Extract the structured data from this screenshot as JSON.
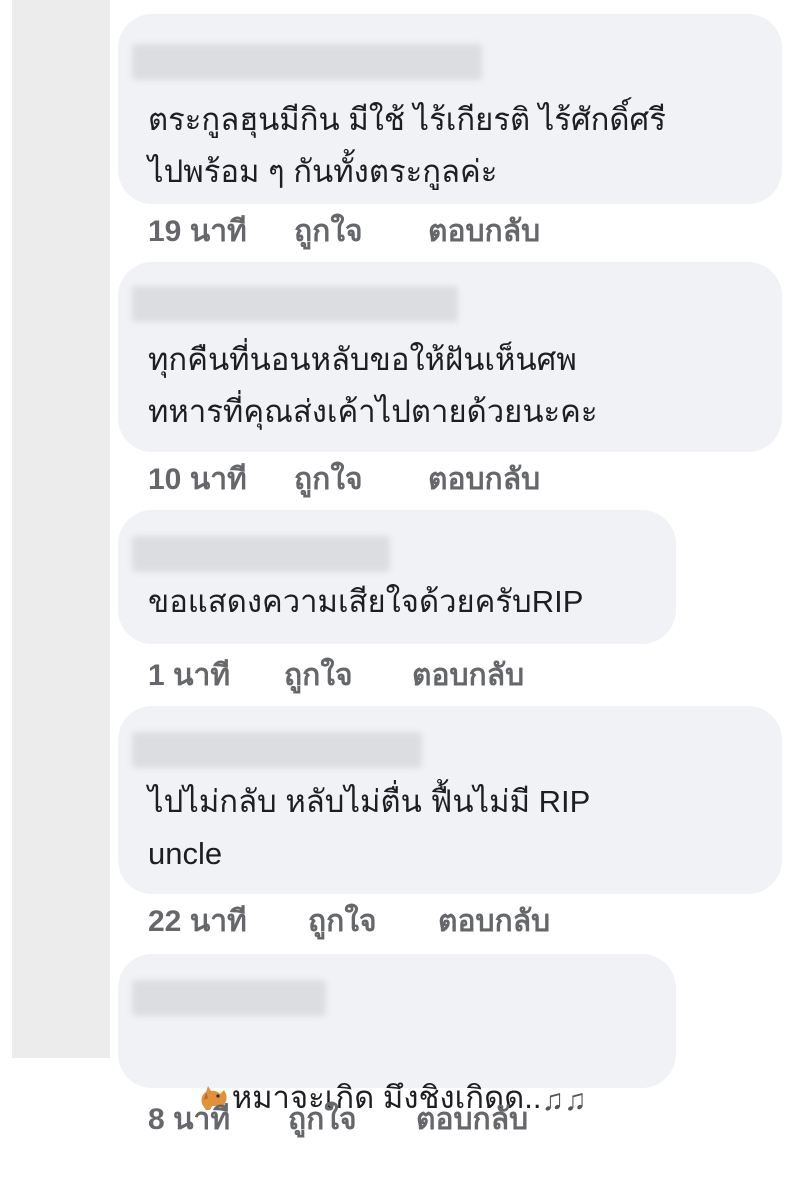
{
  "comments": [
    {
      "text": "ตระกูลฮุนมีกิน มีใช้ ไร้เกียรติ ไร้ศักดิ์ศรี\nไปพร้อม ๆ กันทั้งตระกูลค่ะ",
      "time": "19 นาที",
      "like": "ถูกใจ",
      "reply": "ตอบกลับ"
    },
    {
      "text": "ทุกคืนที่นอนหลับขอให้ฝันเห็นศพ\nทหารที่คุณส่งเค้าไปตายด้วยนะคะ",
      "time": "10 นาที",
      "like": "ถูกใจ",
      "reply": "ตอบกลับ"
    },
    {
      "text": "ขอแสดงความเสียใจด้วยครับRIP",
      "time": "1 นาที",
      "like": "ถูกใจ",
      "reply": "ตอบกลับ"
    },
    {
      "text": "ไปไม่กลับ หลับไม่ตื่น ฟื้นไม่มี RIP\nuncle",
      "time": "22 นาที",
      "like": "ถูกใจ",
      "reply": "ตอบกลับ"
    },
    {
      "text": "หมาจะเกิด มึงชิงเกิดด..",
      "leading_icon": "dog-emoji-icon",
      "trailing_icon": "music-notes-icon",
      "time": "8 นาที",
      "like": "ถูกใจ",
      "reply": "ตอบกลับ"
    }
  ]
}
